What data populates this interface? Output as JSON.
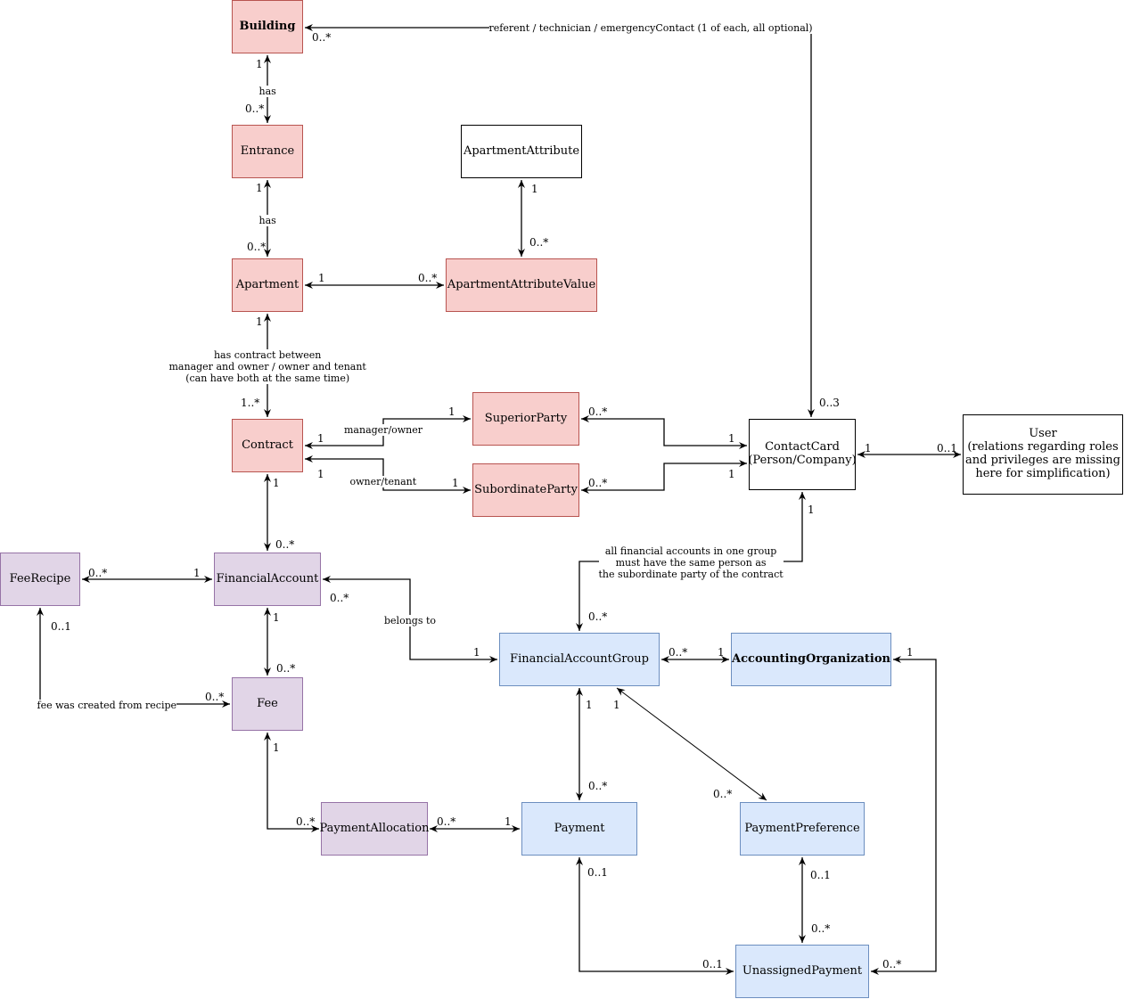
{
  "diagram": {
    "type": "uml-class-diagram",
    "entities": [
      {
        "id": "building",
        "label": "Building",
        "color": "#f8cecc",
        "bold": true
      },
      {
        "id": "entrance",
        "label": "Entrance",
        "color": "#f8cecc"
      },
      {
        "id": "apartment",
        "label": "Apartment",
        "color": "#f8cecc"
      },
      {
        "id": "apartment-attribute",
        "label": "ApartmentAttribute",
        "color": "#ffffff"
      },
      {
        "id": "apartment-attribute-value",
        "label": "ApartmentAttributeValue",
        "color": "#f8cecc"
      },
      {
        "id": "contract",
        "label": "Contract",
        "color": "#f8cecc"
      },
      {
        "id": "superior-party",
        "label": "SuperiorParty",
        "color": "#f8cecc"
      },
      {
        "id": "subordinate-party",
        "label": "SubordinateParty",
        "color": "#f8cecc"
      },
      {
        "id": "contact-card",
        "label": "ContactCard\n(Person/Company)",
        "color": "#ffffff"
      },
      {
        "id": "user",
        "label": "User\n(relations regarding roles\nand privileges are missing\nhere for simplification)",
        "color": "#ffffff"
      },
      {
        "id": "fee-recipe",
        "label": "FeeRecipe",
        "color": "#e1d5e7"
      },
      {
        "id": "financial-account",
        "label": "FinancialAccount",
        "color": "#e1d5e7"
      },
      {
        "id": "fee",
        "label": "Fee",
        "color": "#e1d5e7"
      },
      {
        "id": "payment-allocation",
        "label": "PaymentAllocation",
        "color": "#e1d5e7"
      },
      {
        "id": "financial-account-group",
        "label": "FinancialAccountGroup",
        "color": "#dae8fc"
      },
      {
        "id": "accounting-organization",
        "label": "AccountingOrganization",
        "color": "#dae8fc",
        "bold": true
      },
      {
        "id": "payment",
        "label": "Payment",
        "color": "#dae8fc"
      },
      {
        "id": "payment-preference",
        "label": "PaymentPreference",
        "color": "#dae8fc"
      },
      {
        "id": "unassigned-payment",
        "label": "UnassignedPayment",
        "color": "#dae8fc"
      }
    ],
    "relations": [
      {
        "from": "building",
        "to": "entrance",
        "label": "has",
        "from_mult": "1",
        "to_mult": "0..*"
      },
      {
        "from": "entrance",
        "to": "apartment",
        "label": "has",
        "from_mult": "1",
        "to_mult": "0..*"
      },
      {
        "from": "apartment",
        "to": "apartment-attribute-value",
        "label": "",
        "from_mult": "1",
        "to_mult": "0..*"
      },
      {
        "from": "apartment-attribute",
        "to": "apartment-attribute-value",
        "label": "",
        "from_mult": "1",
        "to_mult": "0..*"
      },
      {
        "from": "apartment",
        "to": "contract",
        "label": "has contract between\nmanager and owner / owner and tenant\n(can have both at the same time)",
        "from_mult": "1",
        "to_mult": "1..*"
      },
      {
        "from": "contract",
        "to": "superior-party",
        "label": "manager/owner",
        "from_mult": "1",
        "to_mult": "1"
      },
      {
        "from": "contract",
        "to": "subordinate-party",
        "label": "owner/tenant",
        "from_mult": "1",
        "to_mult": "1"
      },
      {
        "from": "superior-party",
        "to": "contact-card",
        "label": "",
        "from_mult": "0..*",
        "to_mult": "1"
      },
      {
        "from": "subordinate-party",
        "to": "contact-card",
        "label": "",
        "from_mult": "0..*",
        "to_mult": "1"
      },
      {
        "from": "contact-card",
        "to": "building",
        "label": "referent / technician / emergencyContact (1 of each, all optional)",
        "from_mult": "0..3",
        "to_mult": "0..*"
      },
      {
        "from": "contact-card",
        "to": "user",
        "label": "",
        "from_mult": "1",
        "to_mult": "0..1"
      },
      {
        "from": "contract",
        "to": "financial-account",
        "label": "",
        "from_mult": "1",
        "to_mult": "0..*"
      },
      {
        "from": "fee-recipe",
        "to": "financial-account",
        "label": "",
        "from_mult": "0..*",
        "to_mult": "1"
      },
      {
        "from": "financial-account",
        "to": "fee",
        "label": "",
        "from_mult": "1",
        "to_mult": "0..*"
      },
      {
        "from": "fee-recipe",
        "to": "fee",
        "label": "fee was created from recipe",
        "from_mult": "0..1",
        "to_mult": "0..*"
      },
      {
        "from": "financial-account",
        "to": "financial-account-group",
        "label": "belongs to",
        "from_mult": "0..*",
        "to_mult": "1"
      },
      {
        "from": "contact-card",
        "to": "financial-account-group",
        "label": "all financial accounts in one group\nmust have the same person as\nthe subordinate party of the contract",
        "from_mult": "1",
        "to_mult": "0..*"
      },
      {
        "from": "financial-account-group",
        "to": "accounting-organization",
        "label": "",
        "from_mult": "0..*",
        "to_mult": "1"
      },
      {
        "from": "fee",
        "to": "payment-allocation",
        "label": "",
        "from_mult": "1",
        "to_mult": "0..*"
      },
      {
        "from": "payment-allocation",
        "to": "payment",
        "label": "",
        "from_mult": "0..*",
        "to_mult": "1"
      },
      {
        "from": "financial-account-group",
        "to": "payment",
        "label": "",
        "from_mult": "1",
        "to_mult": "0..*"
      },
      {
        "from": "financial-account-group",
        "to": "payment-preference",
        "label": "",
        "from_mult": "1",
        "to_mult": "0..*"
      },
      {
        "from": "payment-preference",
        "to": "unassigned-payment",
        "label": "",
        "from_mult": "0..1",
        "to_mult": "0..*"
      },
      {
        "from": "payment",
        "to": "unassigned-payment",
        "label": "",
        "from_mult": "0..1",
        "to_mult": "0..1"
      },
      {
        "from": "accounting-organization",
        "to": "unassigned-payment",
        "label": "",
        "from_mult": "1",
        "to_mult": "0..*"
      }
    ]
  }
}
